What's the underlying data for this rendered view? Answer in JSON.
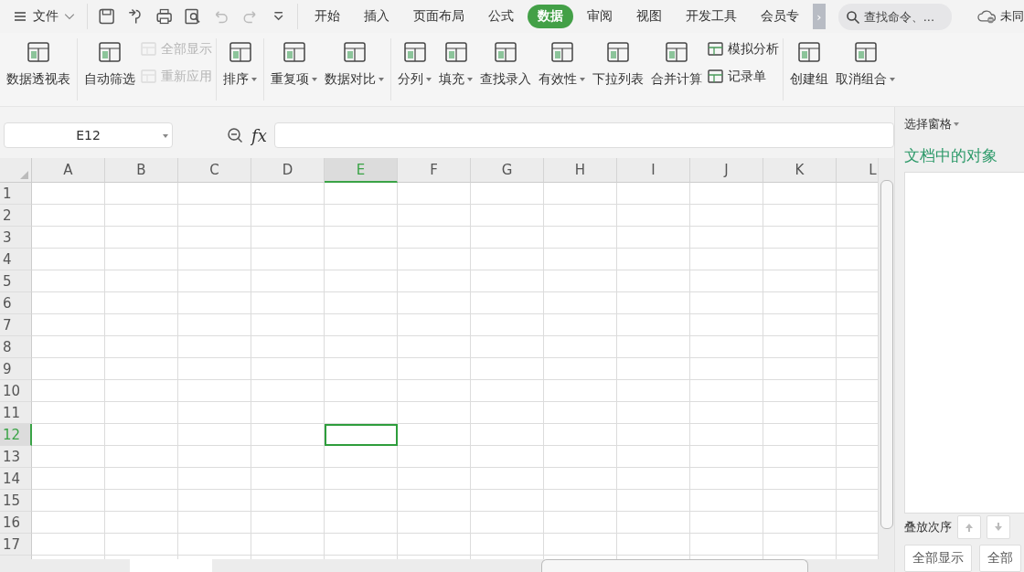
{
  "menu": {
    "file_label": "文件",
    "tabs": [
      {
        "label": "开始",
        "selected": false
      },
      {
        "label": "插入",
        "selected": false
      },
      {
        "label": "页面布局",
        "selected": false
      },
      {
        "label": "公式",
        "selected": false
      },
      {
        "label": "数据",
        "selected": true
      },
      {
        "label": "审阅",
        "selected": false
      },
      {
        "label": "视图",
        "selected": false
      },
      {
        "label": "开发工具",
        "selected": false
      },
      {
        "label": "会员专",
        "selected": false
      }
    ],
    "more": "›",
    "search": {
      "placeholder": "查找命令、..."
    },
    "sync_label": "未同"
  },
  "ribbon": [
    {
      "items": [
        {
          "kind": "big",
          "label": "数据透视表",
          "dropdown": false
        }
      ]
    },
    {
      "items": [
        {
          "kind": "big",
          "label": "自动筛选",
          "dropdown": false
        },
        {
          "kind": "small",
          "label": "全部显示",
          "disabled": true
        },
        {
          "kind": "small",
          "label": "重新应用",
          "disabled": true
        }
      ]
    },
    {
      "items": [
        {
          "kind": "big",
          "label": "排序",
          "dropdown": true
        }
      ]
    },
    {
      "items": [
        {
          "kind": "big",
          "label": "重复项",
          "dropdown": true
        },
        {
          "kind": "big",
          "label": "数据对比",
          "dropdown": true
        }
      ]
    },
    {
      "items": [
        {
          "kind": "big",
          "label": "分列",
          "dropdown": true
        },
        {
          "kind": "big",
          "label": "填充",
          "dropdown": true
        },
        {
          "kind": "big",
          "label": "查找录入",
          "dropdown": false
        },
        {
          "kind": "big",
          "label": "有效性",
          "dropdown": true
        },
        {
          "kind": "big",
          "label": "下拉列表",
          "dropdown": false
        },
        {
          "kind": "big",
          "label": "合并计算",
          "dropdown": false
        },
        {
          "kind": "small",
          "label": "模拟分析",
          "disabled": false
        },
        {
          "kind": "small",
          "label": "记录单",
          "disabled": false
        }
      ]
    },
    {
      "items": [
        {
          "kind": "big",
          "label": "创建组",
          "dropdown": false
        },
        {
          "kind": "big",
          "label": "取消组合",
          "dropdown": true
        }
      ]
    }
  ],
  "formula_bar": {
    "name_box": "E12",
    "fx": "fx"
  },
  "grid": {
    "columns": [
      {
        "label": "A",
        "selected": false
      },
      {
        "label": "B",
        "selected": false
      },
      {
        "label": "C",
        "selected": false
      },
      {
        "label": "D",
        "selected": false
      },
      {
        "label": "E",
        "selected": true
      },
      {
        "label": "F",
        "selected": false
      },
      {
        "label": "G",
        "selected": false
      },
      {
        "label": "H",
        "selected": false
      },
      {
        "label": "I",
        "selected": false
      },
      {
        "label": "J",
        "selected": false
      },
      {
        "label": "K",
        "selected": false
      },
      {
        "label": "L",
        "selected": false
      }
    ],
    "rows": [
      {
        "label": "1",
        "selected": false
      },
      {
        "label": "2",
        "selected": false
      },
      {
        "label": "3",
        "selected": false
      },
      {
        "label": "4",
        "selected": false
      },
      {
        "label": "5",
        "selected": false
      },
      {
        "label": "6",
        "selected": false
      },
      {
        "label": "7",
        "selected": false
      },
      {
        "label": "8",
        "selected": false
      },
      {
        "label": "9",
        "selected": false
      },
      {
        "label": "10",
        "selected": false
      },
      {
        "label": "11",
        "selected": false
      },
      {
        "label": "12",
        "selected": true
      },
      {
        "label": "13",
        "selected": false
      },
      {
        "label": "14",
        "selected": false
      },
      {
        "label": "15",
        "selected": false
      },
      {
        "label": "16",
        "selected": false
      },
      {
        "label": "17",
        "selected": false
      }
    ]
  },
  "side_panel": {
    "title": "选择窗格",
    "heading": "文档中的对象",
    "order_label": "叠放次序",
    "buttons": [
      "全部显示",
      "全部"
    ]
  }
}
